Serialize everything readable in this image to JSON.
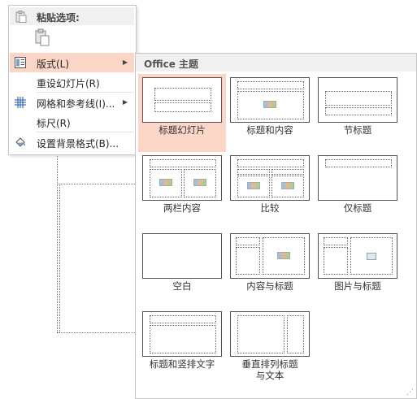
{
  "context_menu": {
    "paste_options_label": "粘贴选项:",
    "items": [
      {
        "label": "版式(L)",
        "icon": "layout-icon",
        "has_submenu": true,
        "active": true
      },
      {
        "label": "重设幻灯片(R)",
        "icon": "",
        "has_submenu": false
      },
      {
        "label": "网格和参考线(I)...",
        "icon": "grid-icon",
        "has_submenu": true
      },
      {
        "label": "标尺(R)",
        "icon": "",
        "has_submenu": false
      },
      {
        "label": "设置背景格式(B)...",
        "icon": "paint-bucket-icon",
        "has_submenu": false
      }
    ]
  },
  "layout_gallery": {
    "title": "Office 主题",
    "layouts": [
      {
        "name": "标题幻灯片",
        "selected": true
      },
      {
        "name": "标题和内容"
      },
      {
        "name": "节标题"
      },
      {
        "name": "两栏内容"
      },
      {
        "name": "比较"
      },
      {
        "name": "仅标题"
      },
      {
        "name": "空白"
      },
      {
        "name": "内容与标题"
      },
      {
        "name": "图片与标题"
      },
      {
        "name": "标题和竖排文字"
      },
      {
        "name": "垂直排列标题与文本"
      }
    ]
  },
  "colors": {
    "selection": "#fbd5c5",
    "menu_header_bg": "#f0f0f0"
  }
}
